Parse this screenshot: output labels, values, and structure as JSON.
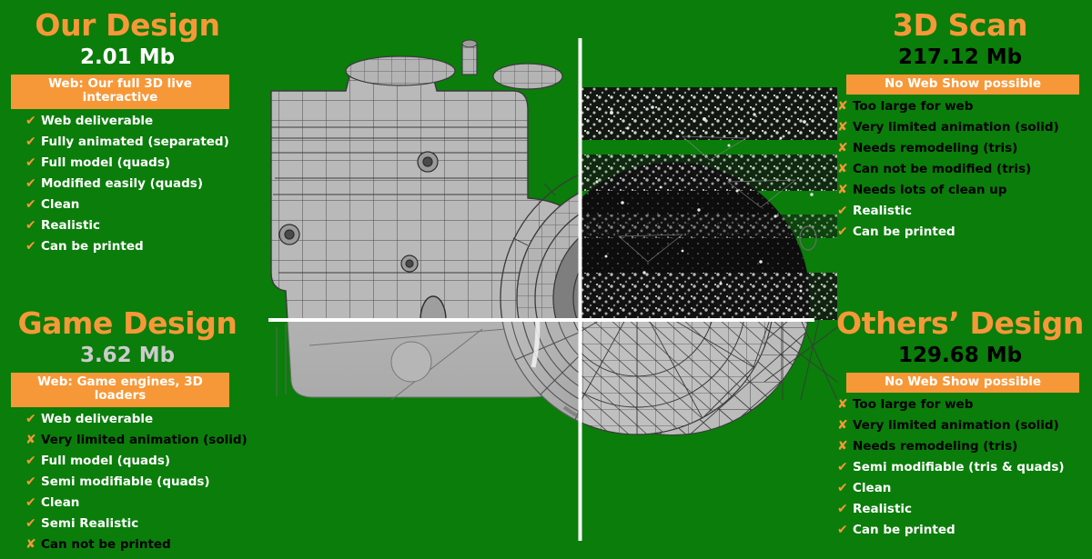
{
  "theme": {
    "background_green": "#0a7d0a",
    "accent_orange": "#f79838",
    "white": "#ffffff",
    "black": "#000000",
    "gray": "#cccccc"
  },
  "panels": {
    "our_design": {
      "title": "Our Design",
      "size": "2.01 Mb",
      "size_color": "white",
      "banner": "Web: Our full 3D live interactive",
      "features": [
        {
          "mark": "check",
          "text": "Web deliverable",
          "tone": "good"
        },
        {
          "mark": "check",
          "text": "Fully animated (separated)",
          "tone": "good"
        },
        {
          "mark": "check",
          "text": "Full model (quads)",
          "tone": "good"
        },
        {
          "mark": "check",
          "text": "Modified easily (quads)",
          "tone": "good"
        },
        {
          "mark": "check",
          "text": "Clean",
          "tone": "good"
        },
        {
          "mark": "check",
          "text": "Realistic",
          "tone": "good"
        },
        {
          "mark": "check",
          "text": "Can be printed",
          "tone": "good"
        }
      ]
    },
    "game_design": {
      "title": "Game Design",
      "size": "3.62 Mb",
      "size_color": "gray",
      "banner": "Web: Game engines, 3D loaders",
      "features": [
        {
          "mark": "check",
          "text": "Web deliverable",
          "tone": "good"
        },
        {
          "mark": "cross",
          "text": "Very limited animation (solid)",
          "tone": "bad"
        },
        {
          "mark": "check",
          "text": "Full model (quads)",
          "tone": "good"
        },
        {
          "mark": "check",
          "text": "Semi modifiable (quads)",
          "tone": "good"
        },
        {
          "mark": "check",
          "text": "Clean",
          "tone": "good"
        },
        {
          "mark": "check",
          "text": "Semi Realistic",
          "tone": "good"
        },
        {
          "mark": "cross",
          "text": "Can not be printed",
          "tone": "bad"
        }
      ]
    },
    "scan_3d": {
      "title": "3D Scan",
      "size": "217.12 Mb",
      "size_color": "black",
      "banner": "No Web Show possible",
      "features": [
        {
          "mark": "cross",
          "text": "Too large for web",
          "tone": "bad"
        },
        {
          "mark": "cross",
          "text": "Very limited animation (solid)",
          "tone": "bad"
        },
        {
          "mark": "cross",
          "text": "Needs remodeling (tris)",
          "tone": "bad"
        },
        {
          "mark": "cross",
          "text": "Can not be modified (tris)",
          "tone": "bad"
        },
        {
          "mark": "cross",
          "text": "Needs lots of clean up",
          "tone": "bad"
        },
        {
          "mark": "check",
          "text": "Realistic",
          "tone": "good"
        },
        {
          "mark": "check",
          "text": "Can be printed",
          "tone": "good"
        }
      ]
    },
    "others_design": {
      "title": "Others’ Design",
      "size": "129.68 Mb",
      "size_color": "black",
      "banner": "No Web Show possible",
      "features": [
        {
          "mark": "cross",
          "text": "Too large for web",
          "tone": "bad"
        },
        {
          "mark": "cross",
          "text": "Very limited animation (solid)",
          "tone": "bad"
        },
        {
          "mark": "cross",
          "text": "Needs remodeling (tris)",
          "tone": "bad"
        },
        {
          "mark": "check",
          "text": "Semi modifiable (tris & quads)",
          "tone": "good"
        },
        {
          "mark": "check",
          "text": "Clean",
          "tone": "good"
        },
        {
          "mark": "check",
          "text": "Realistic",
          "tone": "good"
        },
        {
          "mark": "check",
          "text": "Can be printed",
          "tone": "good"
        }
      ]
    }
  },
  "render": {
    "description": "Four-quadrant 3D camera model comparison render",
    "divider_color": "#ffffff",
    "quadrants": {
      "top_left": "clean quad wireframe camera body",
      "top_right": "noisy dark 3D scan point cloud",
      "bottom_left": "smooth low-poly game model",
      "bottom_right": "triangulated dense mesh"
    }
  },
  "glyphs": {
    "check": "✔",
    "cross": "✘"
  }
}
